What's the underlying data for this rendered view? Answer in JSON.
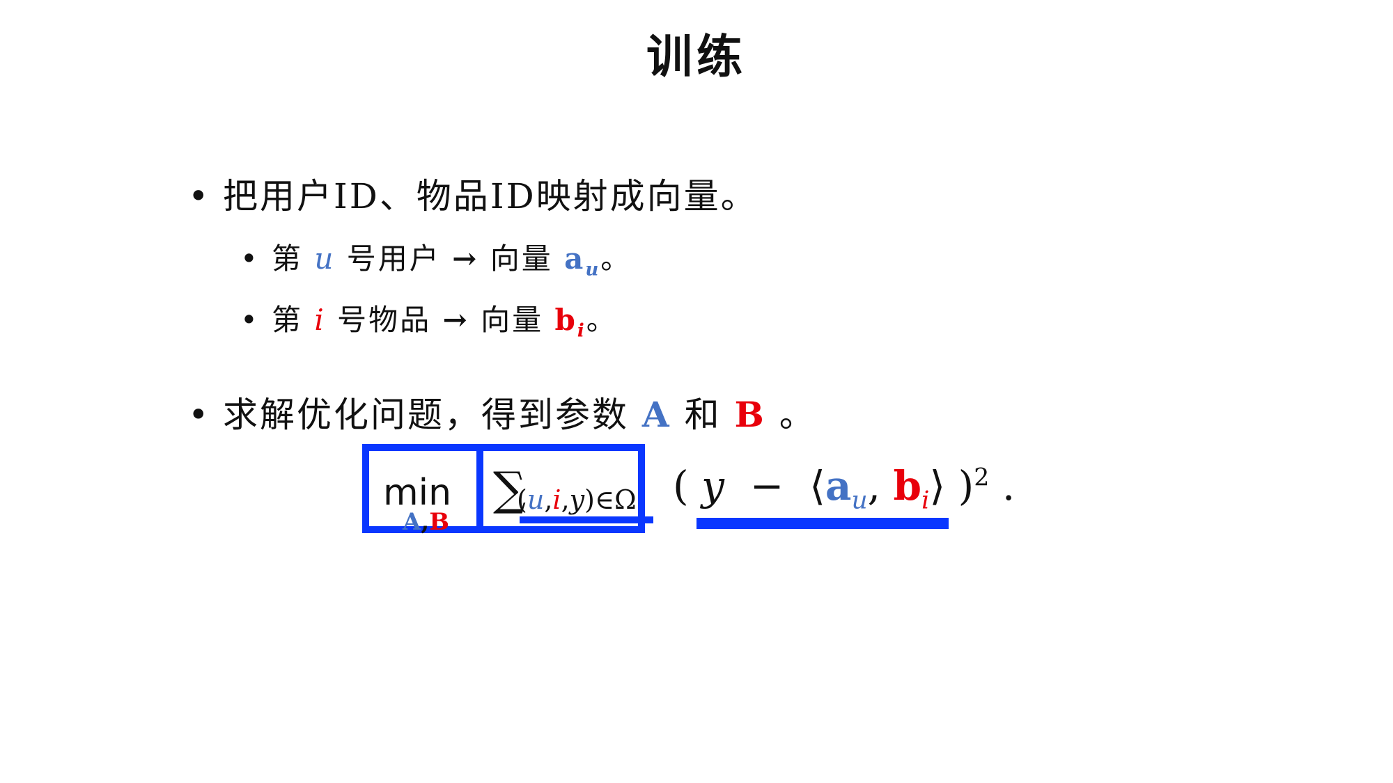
{
  "title": "训练",
  "bullets": {
    "main1": {
      "marker": "•",
      "text": "把用户ID、物品ID映射成向量。"
    },
    "sub1": {
      "marker": "•",
      "prefix": "第",
      "var": "u",
      "middle": "号用户",
      "arrow": "→",
      "label": "向量",
      "vec": "a",
      "vec_sub": "u",
      "end": "。"
    },
    "sub2": {
      "marker": "•",
      "prefix": "第",
      "var": "i",
      "middle": "号物品",
      "arrow": "→",
      "label": "向量",
      "vec": "b",
      "vec_sub": "i",
      "end": "。"
    },
    "main2": {
      "marker": "•",
      "text1": "求解优化问题，得到参数",
      "A": "A",
      "and": "和",
      "B": "B",
      "end": "。"
    }
  },
  "formula": {
    "min": "min",
    "min_sub_A": "A",
    "min_sub_comma": ",",
    "min_sub_B": "B",
    "sigma": "∑",
    "sum_open": "(",
    "sum_u": "u",
    "sum_comma1": ",",
    "sum_i": "i",
    "sum_comma2": ",",
    "sum_y": "y",
    "sum_close": ")∈Ω",
    "open_paren": "(",
    "y": "y",
    "minus": "−",
    "langle": "⟨",
    "a": "a",
    "a_sub": "u",
    "comma": ",",
    "b": "b",
    "b_sub": "i",
    "rangle": "⟩",
    "close_paren": ")",
    "power": "2",
    "period": "."
  },
  "colors": {
    "blue_var": "#4472c4",
    "red_var": "#e8000b",
    "highlight": "#0a37ff"
  }
}
